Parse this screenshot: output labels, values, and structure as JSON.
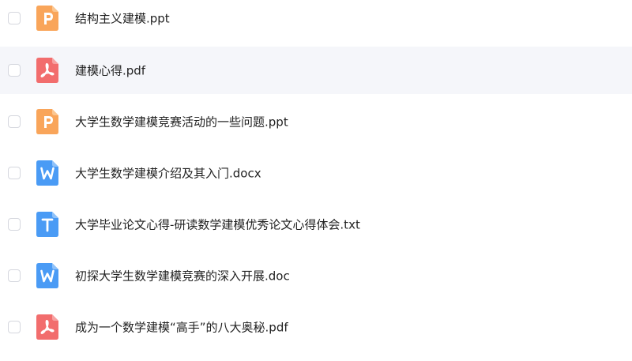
{
  "files": [
    {
      "name": "结构主义建模.ppt",
      "type": "ppt",
      "icon": "ppt-file-icon",
      "color": "#F9A55A"
    },
    {
      "name": "建模心得.pdf",
      "type": "pdf",
      "icon": "pdf-file-icon",
      "color": "#F26D6D"
    },
    {
      "name": "大学生数学建模竞赛活动的一些问题.ppt",
      "type": "ppt",
      "icon": "ppt-file-icon",
      "color": "#F9A55A"
    },
    {
      "name": "大学生数学建模介绍及其入门.docx",
      "type": "doc",
      "icon": "word-file-icon",
      "color": "#4A9BF5"
    },
    {
      "name": "大学毕业论文心得-研读数学建模优秀论文心得体会.txt",
      "type": "txt",
      "icon": "txt-file-icon",
      "color": "#4A9BF5"
    },
    {
      "name": "初探大学生数学建模竞赛的深入开展.doc",
      "type": "doc",
      "icon": "word-file-icon",
      "color": "#4A9BF5"
    },
    {
      "name": "成为一个数学建模“高手”的八大奥秘.pdf",
      "type": "pdf",
      "icon": "pdf-file-icon",
      "color": "#F26D6D"
    }
  ]
}
